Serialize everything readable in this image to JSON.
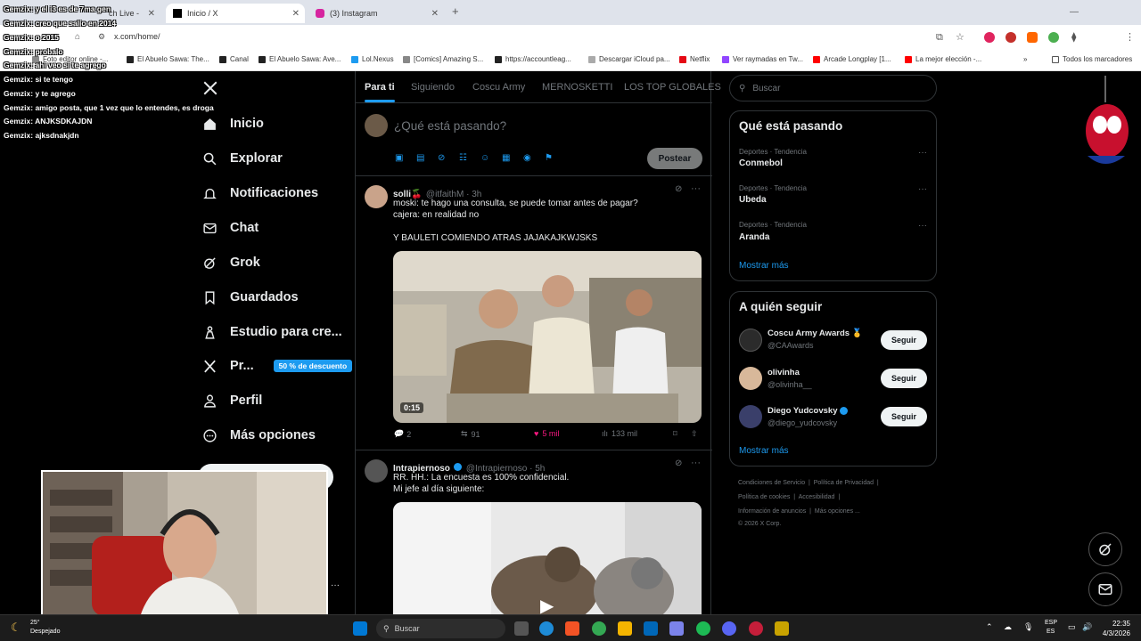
{
  "browser": {
    "tabs": [
      {
        "label": "Inicio / X",
        "active": true
      },
      {
        "label": "(3) Instagram",
        "active": false
      }
    ],
    "hidden_tab_label": "ch Live -",
    "url": "x.com/home/",
    "bookmarks": [
      "Foto editor online -...",
      "El Abuelo Sawa: The...",
      "Canal",
      "El Abuelo Sawa: Ave...",
      "Lol.Nexus",
      "[Comics] Amazing S...",
      "https://accountleag...",
      "Descargar iCloud pa...",
      "Netflix",
      "Ver raymadas en Tw...",
      "Arcade Longplay [1...",
      "La mejor elección -...",
      "Todos los marcadores"
    ]
  },
  "chat": [
    {
      "user": "Gemzix",
      "text": ": y el i3 es de 7ma gen"
    },
    {
      "user": "Gemzix",
      "text": ": creo que salio en 2014"
    },
    {
      "user": "Gemzix",
      "text": ": o 2015"
    },
    {
      "user": "Gemzix",
      "text": ": probalo"
    },
    {
      "user": "Gemzix",
      "text": ": ahi veo si te agrego"
    },
    {
      "user": "Gemzix",
      "text": ": si te tengo"
    },
    {
      "user": "Gemzix",
      "text": ": y te agrego"
    },
    {
      "user": "Gemzix",
      "text": ": amigo posta, que 1 vez que lo entendes, es droga"
    },
    {
      "user": "Gemzix",
      "text": ": ANJKSDKAJDN"
    },
    {
      "user": "Gemzix",
      "text": ": ajksdnakjdn"
    }
  ],
  "nav": {
    "items": [
      {
        "label": "Inicio",
        "icon": "home-icon"
      },
      {
        "label": "Explorar",
        "icon": "search-icon"
      },
      {
        "label": "Notificaciones",
        "icon": "bell-icon"
      },
      {
        "label": "Chat",
        "icon": "mail-icon"
      },
      {
        "label": "Grok",
        "icon": "grok-icon"
      },
      {
        "label": "Guardados",
        "icon": "bookmark-icon"
      },
      {
        "label": "Estudio para cre...",
        "icon": "studio-icon"
      },
      {
        "label": "Pr...",
        "icon": "x-logo-icon"
      },
      {
        "label": "Perfil",
        "icon": "person-icon"
      },
      {
        "label": "Más opciones",
        "icon": "more-circle-icon"
      }
    ],
    "premium_badge": "50 % de descuento"
  },
  "timeline": {
    "tabs": [
      "Para ti",
      "Siguiendo",
      "Coscu Army",
      "MERNOSKETTI",
      "LOS TOP GLOBALES"
    ],
    "composer_placeholder": "¿Qué está pasando?",
    "post_button": "Postear",
    "tweets": [
      {
        "name": "solli🍒",
        "handle": "@itfaithM · 3h",
        "text": "moski: te hago una consulta, se puede tomar antes de pagar?\ncajera: en realidad no\n\nY BAULETI COMIENDO ATRAS JAJAKAJKWJSKS",
        "video_duration": "0:15",
        "replies": "2",
        "reposts": "91",
        "likes": "5 mil",
        "views": "133 mil"
      },
      {
        "name": "Intrapiernoso",
        "handle": "@Intrapiernoso · 5h",
        "text": "RR. HH.: La encuesta es 100% confidencial.\nMi jefe al día siguiente:"
      }
    ]
  },
  "sidebar": {
    "search_placeholder": "Buscar",
    "trends_title": "Qué está pasando",
    "trends": [
      {
        "meta": "Deportes · Tendencia",
        "name": "Conmebol"
      },
      {
        "meta": "Deportes · Tendencia",
        "name": "Ubeda"
      },
      {
        "meta": "Deportes · Tendencia",
        "name": "Aranda"
      }
    ],
    "show_more": "Mostrar más",
    "follow_title": "A quién seguir",
    "follow": [
      {
        "name": "Coscu Army Awards 🥇",
        "handle": "@CAAwards",
        "button": "Seguir"
      },
      {
        "name": "olivinha",
        "handle": "@olivinha__",
        "button": "Seguir"
      },
      {
        "name": "Diego Yudcovsky",
        "handle": "@diego_yudcovsky",
        "button": "Seguir"
      }
    ],
    "footer": [
      "Condiciones de Servicio",
      "Política de Privacidad",
      "Política de cookies",
      "Accesibilidad",
      "Información de anuncios",
      "Más opciones ...",
      "© 2026 X Corp."
    ]
  },
  "taskbar": {
    "weather_temp": "25°",
    "weather_label": "Despejado",
    "search_label": "Buscar",
    "lang": "ESP",
    "lang_sub": "ES",
    "time": "22:35",
    "date": "4/3/2026"
  },
  "colors": {
    "accent": "#1d9bf0",
    "bg": "#000000",
    "border": "#2f3336",
    "like": "#f91880"
  }
}
